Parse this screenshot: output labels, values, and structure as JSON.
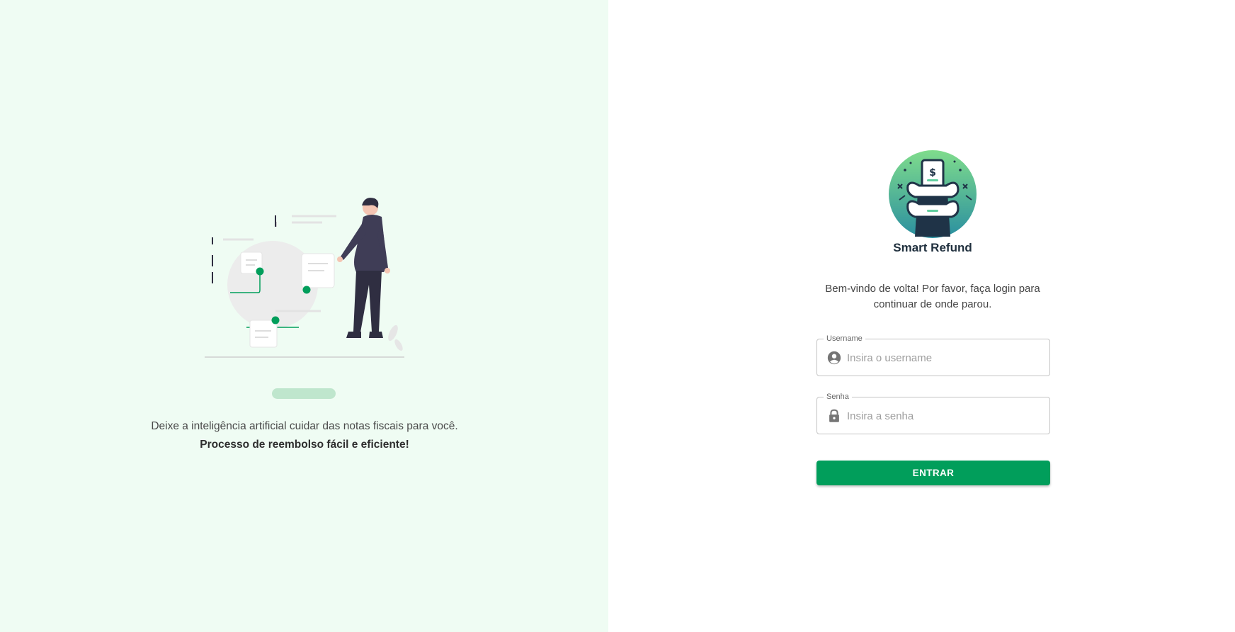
{
  "left_panel": {
    "tagline": "Deixe a inteligência artificial cuidar das notas fiscais para você.",
    "tagline_strong": "Processo de reembolso fácil e eficiente!",
    "illustration_icon": "person-with-documents-illustration"
  },
  "login": {
    "brand_name": "Smart Refund",
    "logo_icon": "refund-receipt-logo",
    "welcome": "Bem-vindo de volta! Por favor, faça login para continuar de onde parou.",
    "username": {
      "label": "Username",
      "placeholder": "Insira o username",
      "value": "",
      "icon": "user-circle-icon"
    },
    "password": {
      "label": "Senha",
      "placeholder": "Insira a senha",
      "value": "",
      "icon": "lock-icon"
    },
    "submit_label": "ENTRAR"
  },
  "colors": {
    "left_background": "#effcf3",
    "accent": "#019e5b",
    "pager_bar": "#bfe6cd"
  }
}
